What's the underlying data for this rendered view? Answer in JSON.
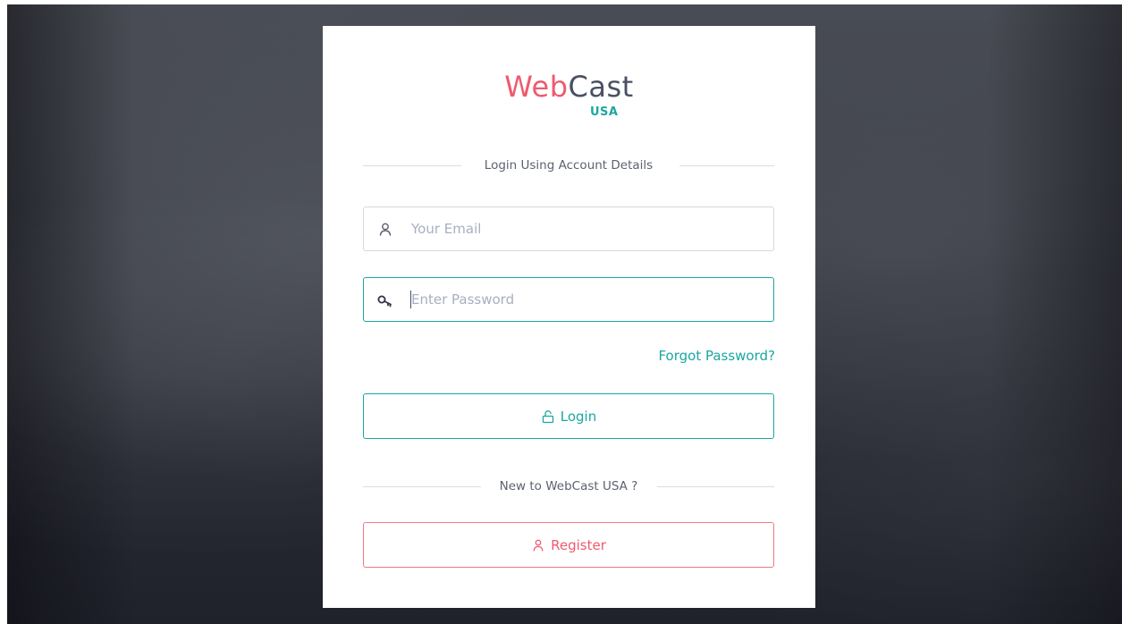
{
  "brand": {
    "name_primary": "Web",
    "name_secondary": "Cast",
    "name_sub": "USA",
    "colors": {
      "primary": "#ee5a6f",
      "secondary": "#4a4f63",
      "accent": "#1aa7a0"
    }
  },
  "login_section": {
    "heading": "Login Using Account Details",
    "email": {
      "placeholder": "Your Email",
      "value": "",
      "icon": "user-icon"
    },
    "password": {
      "placeholder": "Enter Password",
      "value": "",
      "icon": "key-icon"
    },
    "forgot_label": "Forgot Password?",
    "login_button": {
      "label": "Login",
      "icon": "unlock-icon"
    }
  },
  "register_section": {
    "heading": "New to WebCast USA ?",
    "register_button": {
      "label": "Register",
      "icon": "user-icon"
    }
  }
}
